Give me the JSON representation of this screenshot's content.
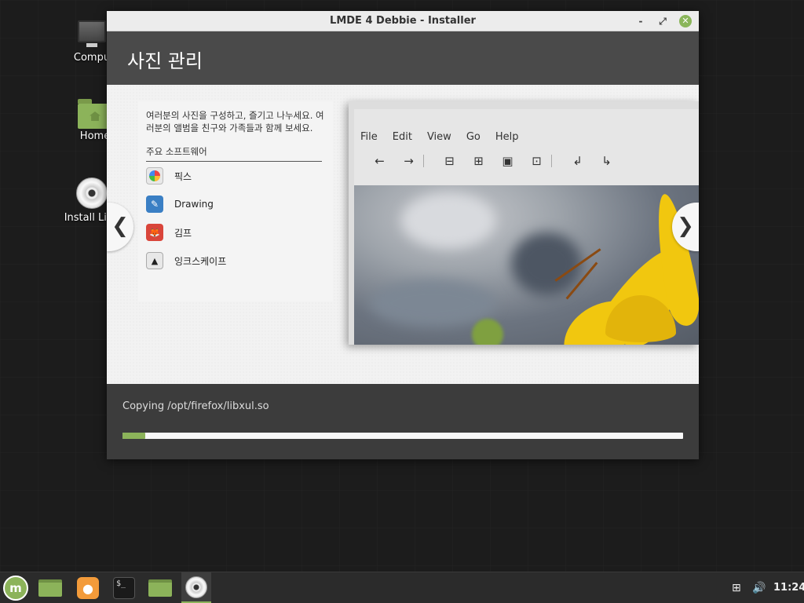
{
  "desktop": {
    "icons": [
      {
        "label": "Compu",
        "icon": "computer-icon"
      },
      {
        "label": "Home",
        "icon": "home-folder-icon"
      },
      {
        "label": "Install Linu",
        "icon": "disc-icon"
      }
    ]
  },
  "window": {
    "title": "LMDE 4 Debbie - Installer",
    "controls": {
      "minimize": "‐",
      "maximize": "⤢",
      "close": "✕"
    }
  },
  "slide": {
    "title": "사진 관리",
    "description": "여러분의 사진을 구성하고, 즐기고 나누세요. 여러분의 앨범을 친구와 가족들과 함께 보세요.",
    "software_heading": "주요 소프트웨어",
    "software": [
      {
        "name": "픽스",
        "icon": "pix-icon"
      },
      {
        "name": "Drawing",
        "icon": "drawing-icon"
      },
      {
        "name": "김프",
        "icon": "gimp-icon"
      },
      {
        "name": "잉크스케이프",
        "icon": "inkscape-icon"
      }
    ],
    "screenshot": {
      "menu": [
        "File",
        "Edit",
        "View",
        "Go",
        "Help"
      ],
      "tools": [
        "back-arrow-icon",
        "forward-arrow-icon",
        "zoom-out-icon",
        "zoom-in-icon",
        "zoom-normal-icon",
        "zoom-fit-icon",
        "rotate-left-icon",
        "rotate-right-icon"
      ]
    },
    "nav": {
      "prev": "❮",
      "next": "❯"
    }
  },
  "progress": {
    "status": "Copying /opt/firefox/libxul.so",
    "fraction": 0.04,
    "color": "#8cb35a"
  },
  "taskbar": {
    "items": [
      "mint-menu-icon",
      "show-desktop-icon",
      "firefox-icon",
      "terminal-icon",
      "files-icon",
      "installer-disc-icon"
    ],
    "clock": "11:24"
  }
}
